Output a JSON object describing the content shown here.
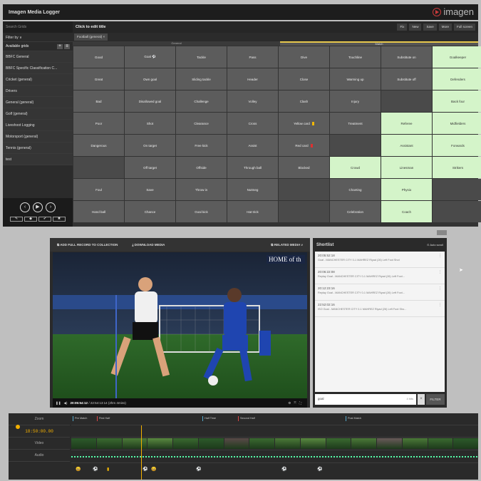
{
  "app": {
    "title": "Imagen Media Logger",
    "logo_text": "imagen",
    "logo_icon": "play-circle-icon",
    "accent": "#c83a3a"
  },
  "sidebar": {
    "search_placeholder": "Search Grids",
    "filter_label": "Filter by ∨",
    "grids_label": "Available grids",
    "grids": [
      "BBFC General",
      "BBFC Specific Classification C...",
      "Cricket (general)",
      "Drivers",
      "General (general)",
      "Golf (general)",
      "Liveshoot Logging",
      "Motorsport (general)",
      "Tennis (general)",
      "test"
    ],
    "transport": {
      "prev": "‹",
      "play": "▶",
      "next": "›"
    },
    "tools": [
      "✎",
      "◆",
      "✔",
      "✖"
    ]
  },
  "main": {
    "title": "Click to edit title",
    "header_buttons": [
      "Fix",
      "New",
      "Save",
      "More",
      "Full screen"
    ],
    "tab": "Football (general) ×",
    "section_general": "General",
    "section_match": "Match",
    "grid": [
      [
        "Good",
        "Goal ⚽",
        "Tackle",
        "Pass",
        "Dive",
        "Touchline",
        "Substitute on",
        "Goalkeeper"
      ],
      [
        "Great",
        "Own goal",
        "Sliding tackle",
        "Header",
        "Close",
        "Warming up",
        "Substitute off",
        "Defenders"
      ],
      [
        "Bad",
        "Disallowed goal",
        "Challenge",
        "Volley",
        "Clash",
        "Injury",
        "",
        "Back four"
      ],
      [
        "Poor",
        "Shot",
        "Clearance",
        "Cross",
        "Yellow card",
        "Treatment",
        "Referee",
        "Midfielders"
      ],
      [
        "Dangerous",
        "On target",
        "Free kick",
        "Assist",
        "Red card",
        "",
        "Assistant",
        "Forwards"
      ],
      [
        "",
        "Off target",
        "Offside",
        "Through ball",
        "Blocked",
        "Crowd",
        "Linesman",
        "Strikers"
      ],
      [
        "Foul",
        "Save",
        "Throw in",
        "Nutmeg",
        "",
        "Chanting",
        "Physio",
        ""
      ],
      [
        "Hand ball",
        "Chance",
        "Goal kick",
        "Hat trick",
        "",
        "Celebration",
        "Coach",
        ""
      ]
    ],
    "green_cells": [
      "5-5",
      "3-6",
      "4-6",
      "5-6",
      "6-6",
      "7-6",
      "0-7",
      "1-7",
      "2-7",
      "3-7",
      "4-7",
      "5-7"
    ]
  },
  "video": {
    "add_full_record": "ADD FULL RECORD TO COLLECTION",
    "download": "DOWNLOAD MEDIA",
    "related": "RELATED MEDIA",
    "timecode": "20:05:54:12",
    "duration": "/ 22:54:13:14 (2hrs 4mins)",
    "broadcast_tag": "HOME of th"
  },
  "shortlist": {
    "title": "Shortlist",
    "autoscroll": "Auto scroll",
    "items": [
      {
        "time": "20:05:52:18",
        "desc": "Goal - MANCHESTER CITY 0-1 MAHREZ Riyad (26) Left Foot Shot"
      },
      {
        "time": "20:06:22:08",
        "desc": "Replay Goal - MANCHESTER CITY 0-1 MAHREZ Riyad (26) Left Foot..."
      },
      {
        "time": "20:12:23:16",
        "desc": "Replay Goal - MANCHESTER CITY 0-1 MAHREZ Riyad (26) Left Foot..."
      },
      {
        "time": "22:52:02:16",
        "desc": "ISO Goal - MANCHESTER CITY 0-1 MAHREZ Riyad (26) Left Foot Sho..."
      }
    ],
    "search_value": "goal",
    "hits": "4 hits",
    "filter_label": "FILTER"
  },
  "timeline": {
    "zoom_label": "Zoom",
    "time": "18:50:00.00",
    "video_label": "Video",
    "audio_label": "Audio",
    "markers": [
      "Pre Match",
      "First Half",
      "Half Time",
      "Second Half",
      "Post Match"
    ],
    "strip_colors": [
      "#2c5a2a",
      "#3a6a30",
      "#4b7a38",
      "#5a8a40",
      "#3a6a30",
      "#2c5a2a",
      "#5a4a48",
      "#3a6a30",
      "#4b7a38",
      "#5a8a40",
      "#3a6a30",
      "#4b7a38",
      "#6a5a5a",
      "#4b7a38",
      "#3a6a30",
      "#2c5a2a"
    ]
  }
}
